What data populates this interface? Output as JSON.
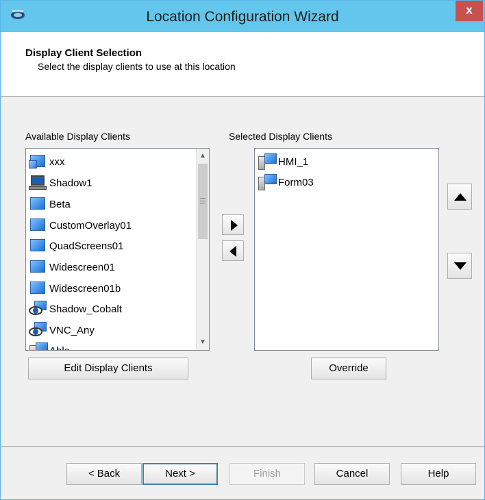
{
  "window": {
    "title": "Location Configuration Wizard",
    "close_label": "x"
  },
  "header": {
    "title": "Display Client Selection",
    "subtitle": "Select the display clients to use at this location"
  },
  "available": {
    "label": "Available Display Clients",
    "items": [
      {
        "label": "xxx",
        "icon": "multi-monitor-icon"
      },
      {
        "label": "Shadow1",
        "icon": "laptop-icon"
      },
      {
        "label": "Beta",
        "icon": "monitor-icon"
      },
      {
        "label": "CustomOverlay01",
        "icon": "monitor-icon"
      },
      {
        "label": "QuadScreens01",
        "icon": "monitor-icon"
      },
      {
        "label": "Widescreen01",
        "icon": "monitor-icon"
      },
      {
        "label": "Widescreen01b",
        "icon": "monitor-icon"
      },
      {
        "label": "Shadow_Cobalt",
        "icon": "eye-monitor-icon"
      },
      {
        "label": "VNC_Any",
        "icon": "eye-monitor-icon"
      },
      {
        "label": "Able",
        "icon": "server-monitor-icon"
      }
    ]
  },
  "selected": {
    "label": "Selected Display Clients",
    "items": [
      {
        "label": "HMI_1",
        "icon": "server-monitor-icon"
      },
      {
        "label": "Form03",
        "icon": "server-monitor-icon"
      }
    ]
  },
  "buttons": {
    "edit_display_clients": "Edit Display Clients",
    "override": "Override",
    "back": "< Back",
    "next": "Next >",
    "finish": "Finish",
    "cancel": "Cancel",
    "help": "Help"
  },
  "icons": {
    "add": "right-triangle-icon",
    "remove": "left-triangle-icon",
    "move_up": "up-triangle-icon",
    "move_down": "down-triangle-icon",
    "scroll_up": "chevron-up-icon",
    "scroll_down": "chevron-down-icon"
  },
  "colors": {
    "titlebar": "#63c6ec",
    "close": "#c75050"
  }
}
